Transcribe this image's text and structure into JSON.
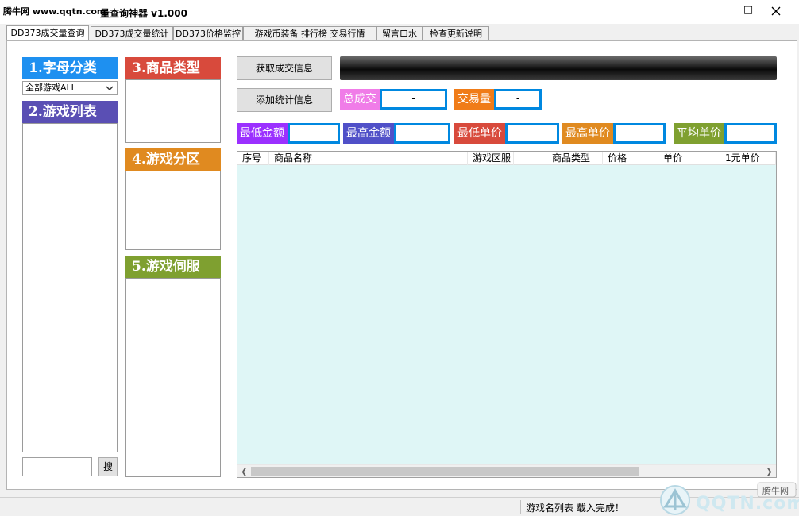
{
  "window": {
    "site_badge": "腾牛网 www.qqtn.com",
    "title_fragment": "量查询神器 v1.000",
    "minimize_glyph": "—",
    "maximize_glyph": "□"
  },
  "tabs": [
    {
      "label": "DD373成交量查询",
      "active": true
    },
    {
      "label": "DD373成交量统计",
      "active": false
    },
    {
      "label": "DD373价格监控",
      "active": false
    },
    {
      "label": "游戏币装备 排行榜 交易行情",
      "active": false
    },
    {
      "label": "留言口水",
      "active": false
    },
    {
      "label": "检查更新说明",
      "active": false
    }
  ],
  "sections": {
    "letter_category": {
      "title": "1.字母分类",
      "color": "#1e90f0",
      "selected": "全部游戏ALL"
    },
    "game_list": {
      "title": "2.游戏列表",
      "color": "#5a4fb4"
    },
    "product_type": {
      "title": "3.商品类型",
      "color": "#d84a3c"
    },
    "game_zone": {
      "title": "4.游戏分区",
      "color": "#e08a20"
    },
    "game_server": {
      "title": "5.游戏伺服",
      "color": "#7fa030"
    }
  },
  "search": {
    "value": "",
    "button_label": "搜"
  },
  "actions": {
    "get_trade_info": "获取成交信息",
    "add_stats_info": "添加统计信息"
  },
  "totals": [
    {
      "label": "总成交",
      "value": "-",
      "color": "#f07ce8"
    },
    {
      "label": "交易量",
      "value": "-",
      "color": "#f07c18"
    }
  ],
  "stats": [
    {
      "label": "最低金额",
      "value": "-",
      "color": "#9b30ff"
    },
    {
      "label": "最高金额",
      "value": "-",
      "color": "#5050c8"
    },
    {
      "label": "最低单价",
      "value": "-",
      "color": "#d84a3c"
    },
    {
      "label": "最高单价",
      "value": "-",
      "color": "#e08a20"
    },
    {
      "label": "平均单价",
      "value": "-",
      "color": "#7fa030"
    }
  ],
  "grid": {
    "columns": [
      "序号",
      "商品名称",
      "游戏区服",
      "商品类型",
      "价格",
      "单价",
      "1元单价"
    ],
    "rows": []
  },
  "status": {
    "text": "游戏名列表 载入完成！"
  },
  "watermark": {
    "brand": "QQTN.com",
    "badge": "腾牛网"
  }
}
